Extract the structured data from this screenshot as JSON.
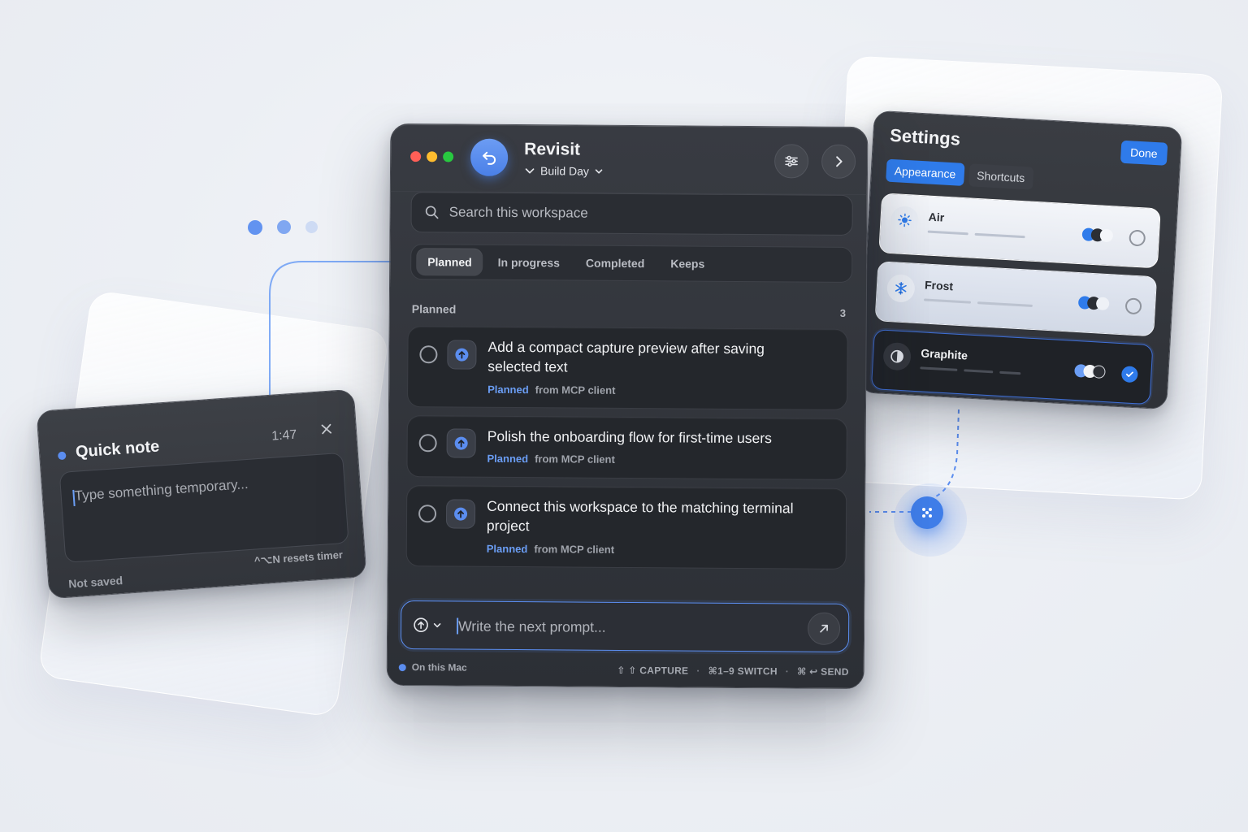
{
  "colors": {
    "accent": "#5b8def",
    "primary_button": "#2f7bea",
    "window_bg": "#2f3238",
    "traffic_red": "#ff5f57",
    "traffic_yellow": "#febc2e",
    "traffic_green": "#28c840"
  },
  "main": {
    "title": "Revisit",
    "workspace": "Build Day",
    "icons": {
      "back": "undo-arrow-icon",
      "filter": "sliders-icon",
      "next": "chevron-right-icon",
      "search": "search-icon"
    },
    "search_placeholder": "Search this workspace",
    "tabs": [
      {
        "label": "Planned",
        "active": true
      },
      {
        "label": "In progress",
        "active": false
      },
      {
        "label": "Completed",
        "active": false
      },
      {
        "label": "Keeps",
        "active": false
      }
    ],
    "section": {
      "label": "Planned",
      "count": "3"
    },
    "tasks": [
      {
        "title": "Add a compact capture preview after saving selected text",
        "status": "Planned",
        "source": "from MCP client"
      },
      {
        "title": "Polish the onboarding flow for first-time users",
        "status": "Planned",
        "source": "from MCP client"
      },
      {
        "title": "Connect this workspace to the matching terminal project",
        "status": "Planned",
        "source": "from MCP client"
      }
    ],
    "prompt_placeholder": "Write the next prompt...",
    "status_bar": {
      "location": "On this Mac",
      "shortcuts": [
        "⇧ ⇧ CAPTURE",
        "⌘1–9 SWITCH",
        "⌘ ↩ SEND"
      ],
      "separator": "·"
    }
  },
  "quick_note": {
    "title": "Quick note",
    "timer": "1:47",
    "placeholder": "Type something temporary...",
    "save_status": "Not saved",
    "hint": "^⌥N resets timer"
  },
  "settings": {
    "title": "Settings",
    "done_label": "Done",
    "tabs": [
      {
        "label": "Appearance",
        "active": true
      },
      {
        "label": "Shortcuts",
        "active": false
      }
    ],
    "themes": [
      {
        "name": "Air",
        "icon": "sun-icon",
        "selected": false
      },
      {
        "name": "Frost",
        "icon": "snowflake-icon",
        "selected": false
      },
      {
        "name": "Graphite",
        "icon": "half-circle-contrast-icon",
        "selected": true
      }
    ]
  }
}
